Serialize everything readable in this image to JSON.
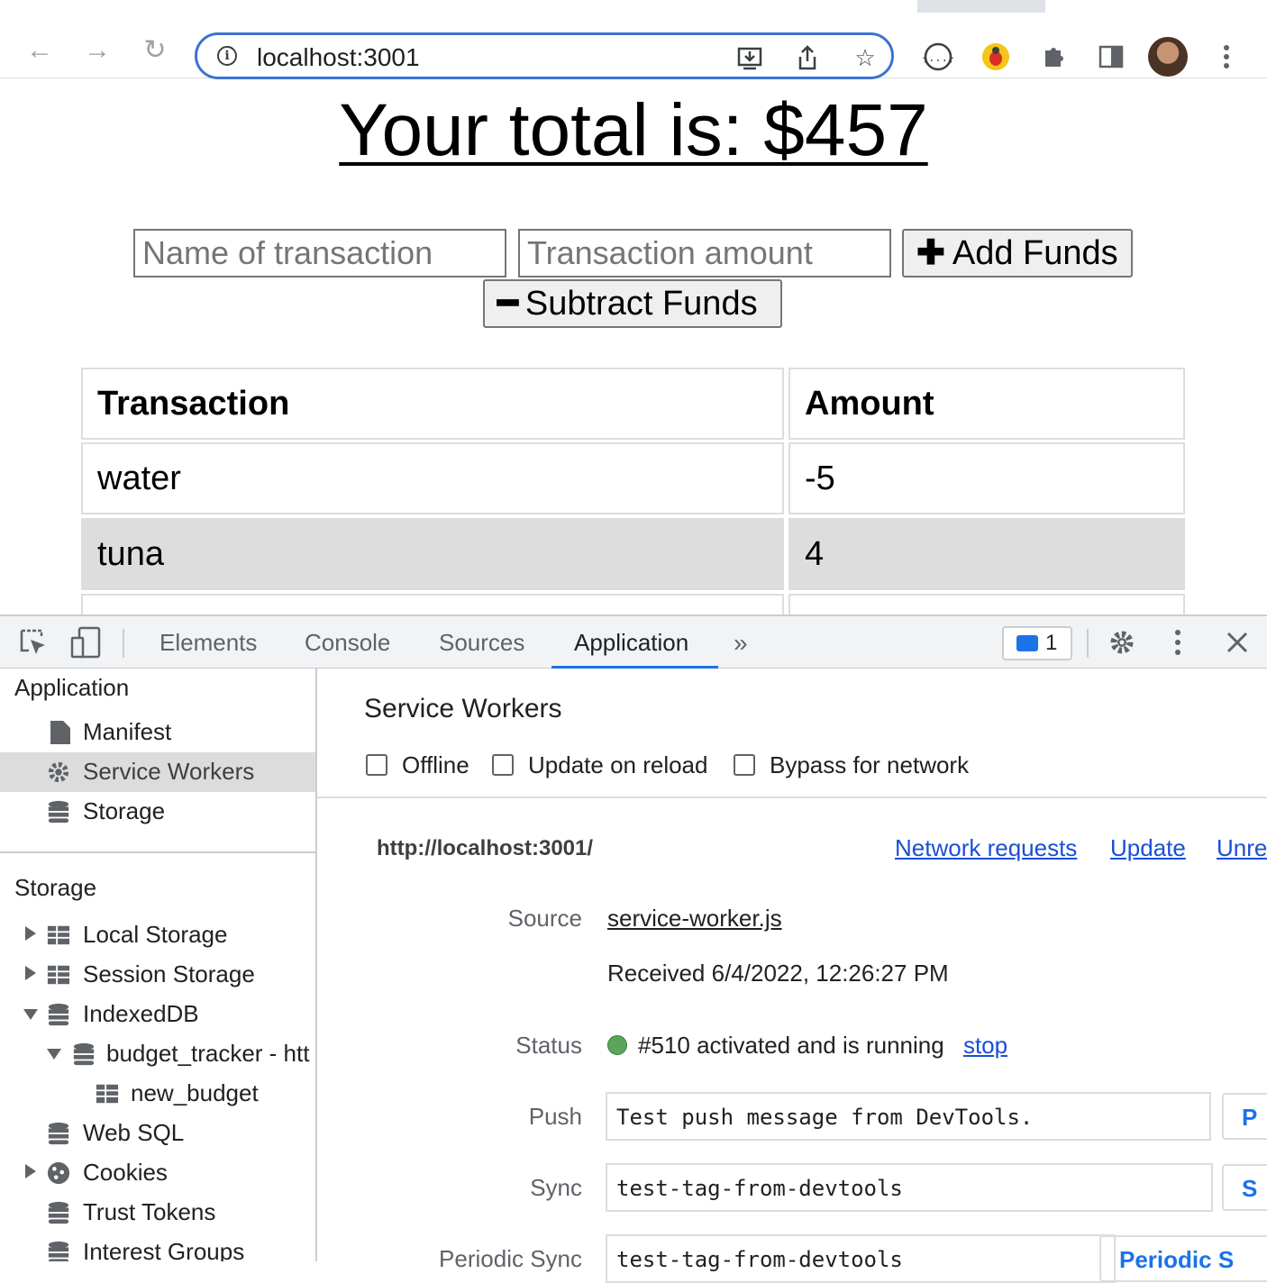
{
  "browser": {
    "url": "localhost:3001"
  },
  "page": {
    "title": "Your total is: $457",
    "name_placeholder": "Name of transaction",
    "amount_placeholder": "Transaction amount",
    "add_label": "Add Funds",
    "subtract_label": "Subtract Funds",
    "table": {
      "headers": [
        "Transaction",
        "Amount"
      ],
      "rows": [
        {
          "name": "water",
          "amount": "-5"
        },
        {
          "name": "tuna",
          "amount": "4"
        }
      ]
    }
  },
  "devtools": {
    "tabs": [
      "Elements",
      "Console",
      "Sources",
      "Application"
    ],
    "active_tab": "Application",
    "message_count": "1",
    "sidebar": {
      "application_header": "Application",
      "application_items": [
        "Manifest",
        "Service Workers",
        "Storage"
      ],
      "storage_header": "Storage",
      "storage_items": [
        "Local Storage",
        "Session Storage",
        "IndexedDB",
        "budget_tracker - htt",
        "new_budget",
        "Web SQL",
        "Cookies",
        "Trust Tokens",
        "Interest Groups"
      ]
    },
    "service_workers": {
      "title": "Service Workers",
      "checkboxes": [
        "Offline",
        "Update on reload",
        "Bypass for network"
      ],
      "origin": "http://localhost:3001/",
      "actions": [
        "Network requests",
        "Update",
        "Unre"
      ],
      "source_label": "Source",
      "source_file": "service-worker.js",
      "received": "Received 6/4/2022, 12:26:27 PM",
      "status_label": "Status",
      "status_text": "#510 activated and is running",
      "status_action": "stop",
      "push_label": "Push",
      "push_value": "Test push message from DevTools.",
      "push_button": "P",
      "sync_label": "Sync",
      "sync_value": "test-tag-from-devtools",
      "sync_button": "S",
      "periodic_label": "Periodic Sync",
      "periodic_value": "test-tag-from-devtools",
      "periodic_button": "Periodic S",
      "status_color": "#5aa55a",
      "link_color": "#1a4fd6"
    }
  }
}
